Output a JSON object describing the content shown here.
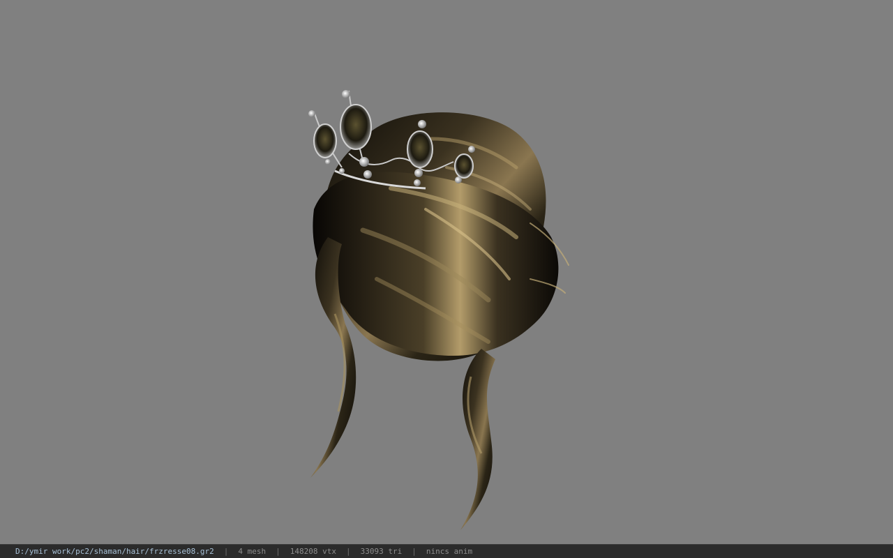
{
  "viewport": {
    "background": "#808080",
    "model_name": "hair model with tiara"
  },
  "statusbar": {
    "file_path": "D:/ymir work/pc2/shaman/hair/frzresse08.gr2",
    "separator": "|",
    "mesh_count": "4 mesh",
    "vertex_count": "148208 vtx",
    "triangle_count": "33093 tri",
    "anim_status": "nincs anim"
  }
}
